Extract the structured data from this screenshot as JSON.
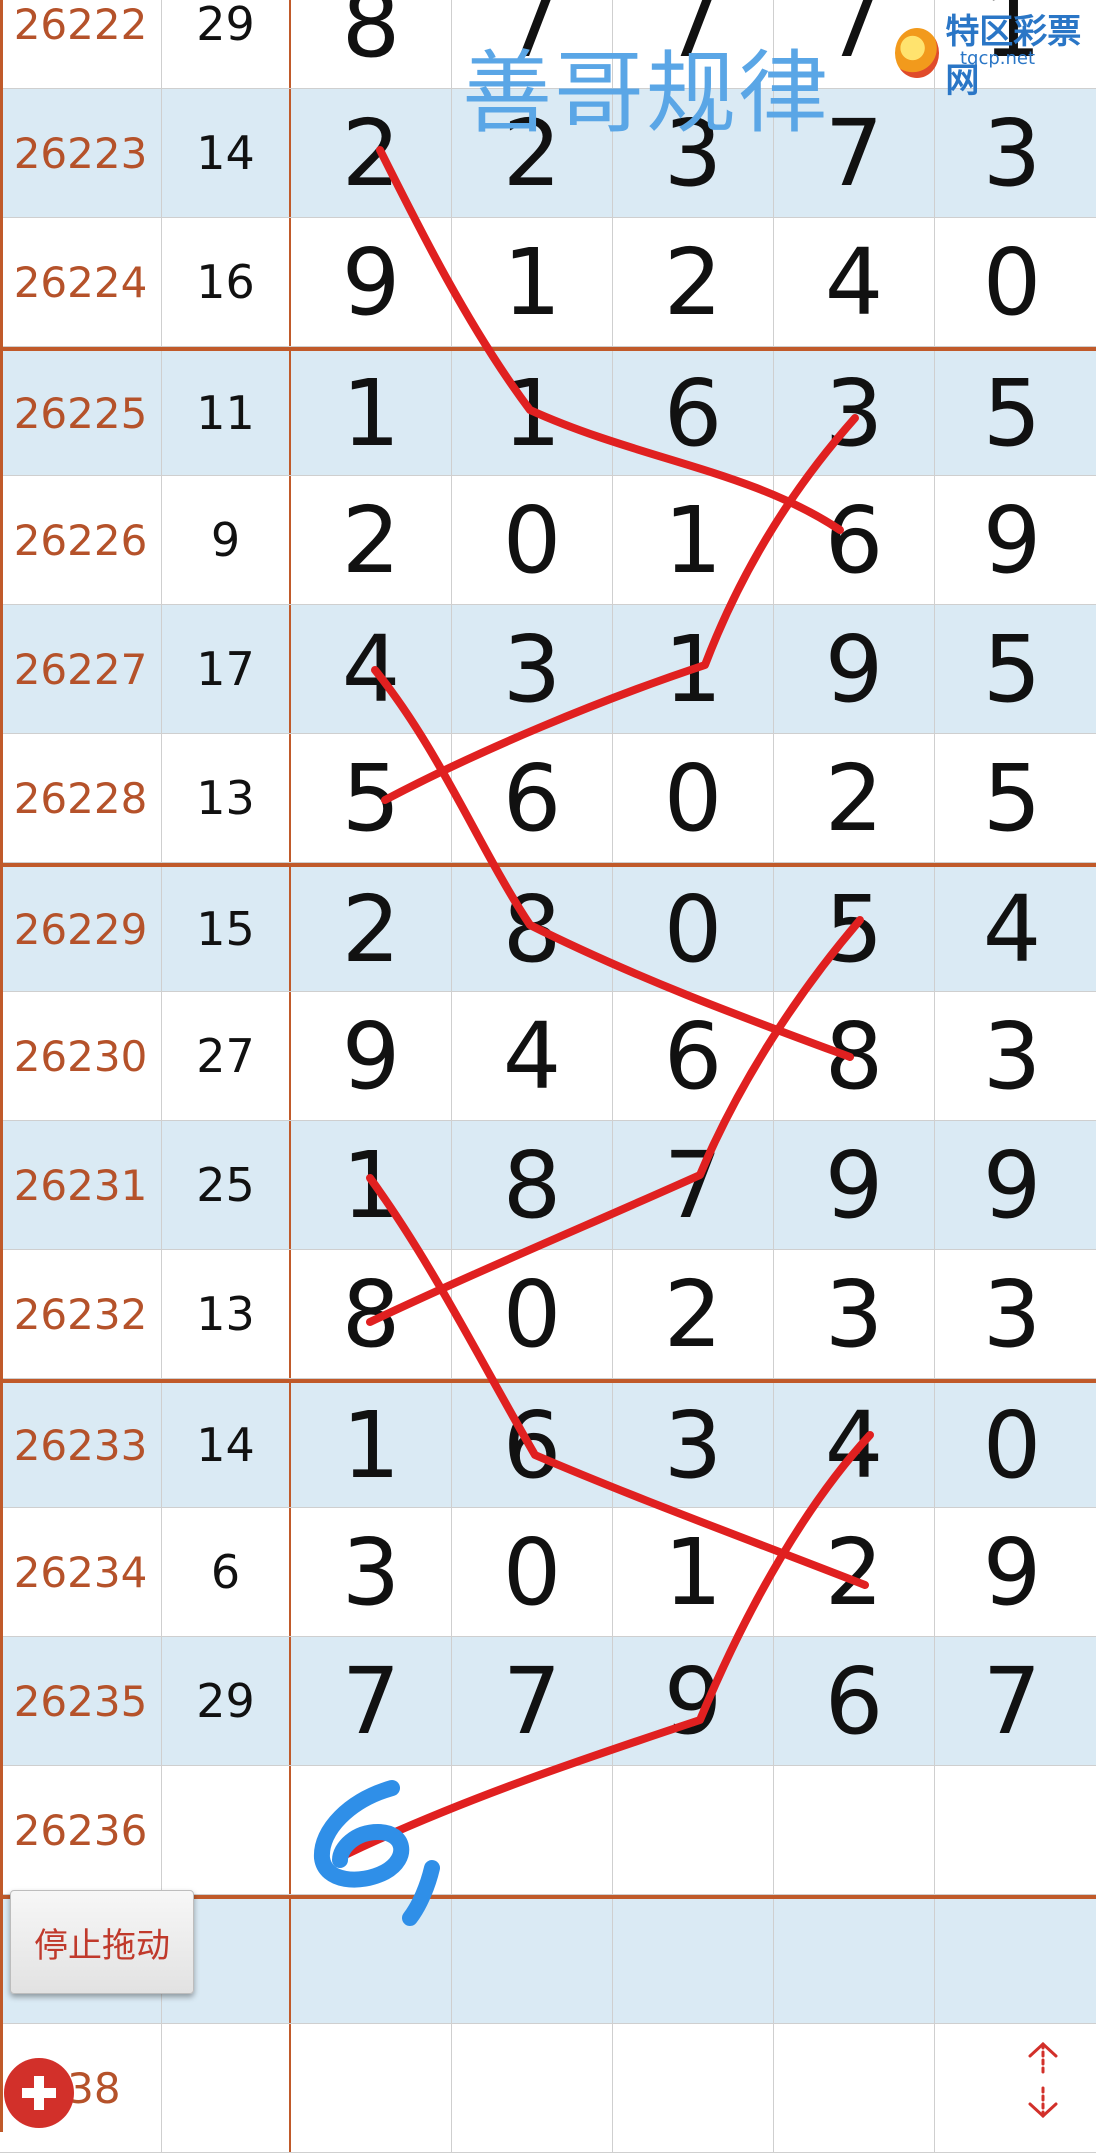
{
  "watermark": "善哥规律",
  "logo": {
    "name": "特区彩票网",
    "url": "tqcp.net"
  },
  "stop_button_label": "停止拖动",
  "rows": [
    {
      "period": "26222",
      "sum": "29",
      "digits": [
        "8",
        "7",
        "7",
        "7",
        "1"
      ],
      "alt": false,
      "group_top": false
    },
    {
      "period": "26223",
      "sum": "14",
      "digits": [
        "2",
        "2",
        "3",
        "7",
        "3"
      ],
      "alt": true,
      "group_top": false
    },
    {
      "period": "26224",
      "sum": "16",
      "digits": [
        "9",
        "1",
        "2",
        "4",
        "0"
      ],
      "alt": false,
      "group_top": false
    },
    {
      "period": "26225",
      "sum": "11",
      "digits": [
        "1",
        "1",
        "6",
        "3",
        "5"
      ],
      "alt": true,
      "group_top": true
    },
    {
      "period": "26226",
      "sum": "9",
      "digits": [
        "2",
        "0",
        "1",
        "6",
        "9"
      ],
      "alt": false,
      "group_top": false
    },
    {
      "period": "26227",
      "sum": "17",
      "digits": [
        "4",
        "3",
        "1",
        "9",
        "5"
      ],
      "alt": true,
      "group_top": false
    },
    {
      "period": "26228",
      "sum": "13",
      "digits": [
        "5",
        "6",
        "0",
        "2",
        "5"
      ],
      "alt": false,
      "group_top": false
    },
    {
      "period": "26229",
      "sum": "15",
      "digits": [
        "2",
        "8",
        "0",
        "5",
        "4"
      ],
      "alt": true,
      "group_top": true
    },
    {
      "period": "26230",
      "sum": "27",
      "digits": [
        "9",
        "4",
        "6",
        "8",
        "3"
      ],
      "alt": false,
      "group_top": false
    },
    {
      "period": "26231",
      "sum": "25",
      "digits": [
        "1",
        "8",
        "7",
        "9",
        "9"
      ],
      "alt": true,
      "group_top": false
    },
    {
      "period": "26232",
      "sum": "13",
      "digits": [
        "8",
        "0",
        "2",
        "3",
        "3"
      ],
      "alt": false,
      "group_top": false
    },
    {
      "period": "26233",
      "sum": "14",
      "digits": [
        "1",
        "6",
        "3",
        "4",
        "0"
      ],
      "alt": true,
      "group_top": true
    },
    {
      "period": "26234",
      "sum": "6",
      "digits": [
        "3",
        "0",
        "1",
        "2",
        "9"
      ],
      "alt": false,
      "group_top": false
    },
    {
      "period": "26235",
      "sum": "29",
      "digits": [
        "7",
        "7",
        "9",
        "6",
        "7"
      ],
      "alt": true,
      "group_top": false
    },
    {
      "period": "26236",
      "sum": "",
      "digits": [
        "",
        "",
        "",
        "",
        ""
      ],
      "alt": false,
      "group_top": false
    },
    {
      "period": "",
      "sum": "",
      "digits": [
        "",
        "",
        "",
        "",
        ""
      ],
      "alt": true,
      "group_top": true
    },
    {
      "period": "238",
      "sum": "",
      "digits": [
        "",
        "",
        "",
        "",
        ""
      ],
      "alt": false,
      "group_top": false
    }
  ],
  "handwritten_prediction": "6,",
  "colors": {
    "accent_line": "#c05a2a",
    "period_text": "#b5522a",
    "alt_row": "#daeaf4",
    "annotation_red": "#e02020",
    "annotation_blue": "#2f8fe8"
  }
}
